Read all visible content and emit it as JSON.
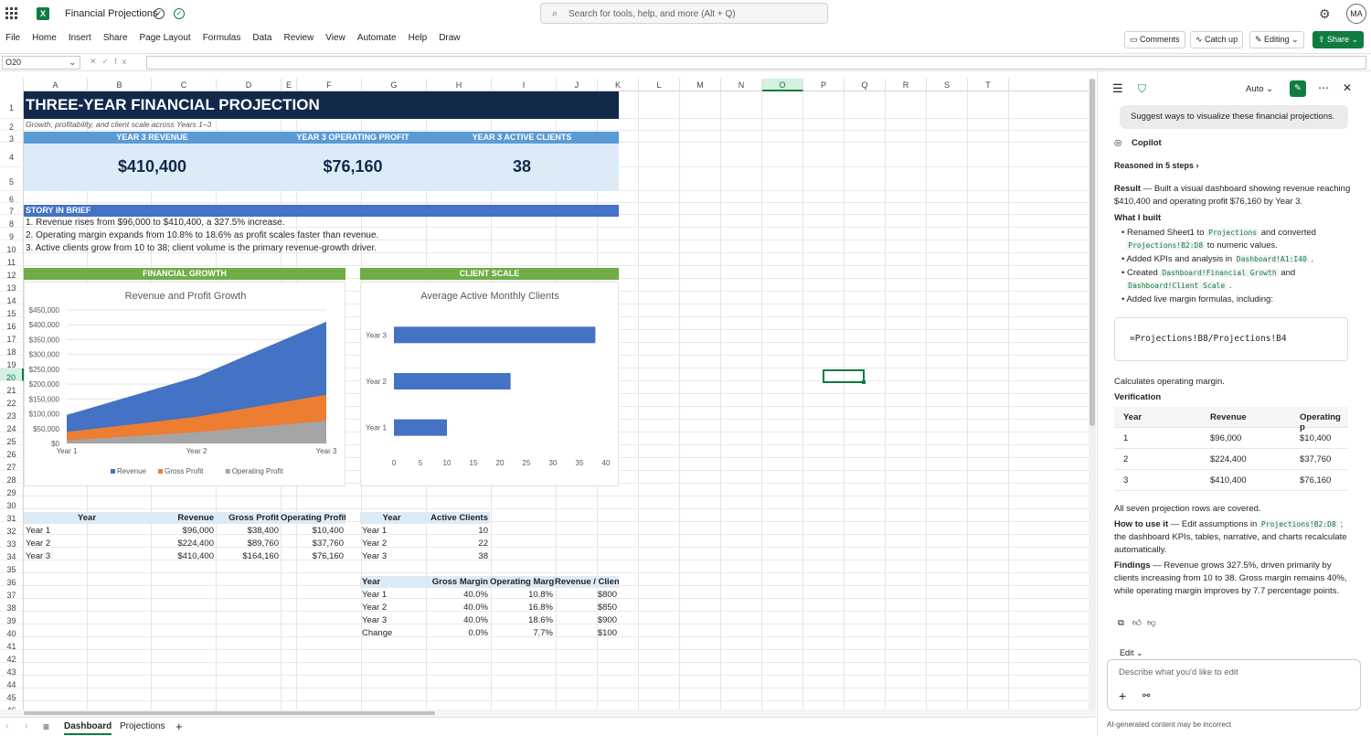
{
  "app": {
    "title": "Financial Projections",
    "search_placeholder": "Search for tools, help, and more (Alt + Q)",
    "avatar": "MA"
  },
  "menu": [
    "File",
    "Home",
    "Insert",
    "Share",
    "Page Layout",
    "Formulas",
    "Data",
    "Review",
    "View",
    "Automate",
    "Help",
    "Draw"
  ],
  "ribbon_buttons": {
    "comments": "Comments",
    "catchup": "Catch up",
    "editing": "Editing",
    "share": "Share"
  },
  "namebox": "O20",
  "columns": [
    "A",
    "B",
    "C",
    "D",
    "E",
    "F",
    "G",
    "H",
    "I",
    "J",
    "K",
    "L",
    "M",
    "N",
    "O",
    "P",
    "Q",
    "R",
    "S",
    "T"
  ],
  "rows": [
    "1",
    "2",
    "3",
    "4",
    "5",
    "6",
    "7",
    "8",
    "9",
    "10",
    "11",
    "12",
    "13",
    "14",
    "15",
    "16",
    "17",
    "18",
    "19",
    "20",
    "21",
    "22",
    "23",
    "24",
    "25",
    "26",
    "27",
    "28",
    "29",
    "30",
    "31",
    "32",
    "33",
    "34",
    "35",
    "36",
    "37",
    "38",
    "39",
    "40",
    "41",
    "42",
    "43",
    "44",
    "45",
    "46"
  ],
  "sheet": {
    "title": "THREE-YEAR FINANCIAL PROJECTION",
    "subtitle": "Growth, profitability, and client scale across Years 1–3",
    "kpis": [
      {
        "label": "YEAR 3 REVENUE",
        "value": "$410,400"
      },
      {
        "label": "YEAR 3 OPERATING PROFIT",
        "value": "$76,160"
      },
      {
        "label": "YEAR 3 ACTIVE CLIENTS",
        "value": "38"
      }
    ],
    "story_title": "STORY IN BRIEF",
    "story": [
      "1. Revenue rises from $96,000 to $410,400, a 327.5% increase.",
      "2. Operating margin expands from 10.8% to 18.6% as profit scales faster than revenue.",
      "3. Active clients grow from 10 to 38; client volume is the primary revenue-growth driver."
    ],
    "sec_growth": "FINANCIAL GROWTH",
    "sec_clients": "CLIENT SCALE",
    "fin_headers": [
      "Year",
      "Revenue",
      "Gross Profit",
      "Operating Profit"
    ],
    "fin_rows": [
      [
        "Year 1",
        "$96,000",
        "$38,400",
        "$10,400"
      ],
      [
        "Year 2",
        "$224,400",
        "$89,760",
        "$37,760"
      ],
      [
        "Year 3",
        "$410,400",
        "$164,160",
        "$76,160"
      ]
    ],
    "cl_headers": [
      "Year",
      "Active Clients"
    ],
    "cl_rows": [
      [
        "Year 1",
        "10"
      ],
      [
        "Year 2",
        "22"
      ],
      [
        "Year 3",
        "38"
      ]
    ],
    "mg_headers": [
      "Year",
      "Gross Margin",
      "Operating Margin",
      "Revenue / Client"
    ],
    "mg_rows": [
      [
        "Year 1",
        "40.0%",
        "10.8%",
        "$800"
      ],
      [
        "Year 2",
        "40.0%",
        "16.8%",
        "$850"
      ],
      [
        "Year 3",
        "40.0%",
        "18.6%",
        "$900"
      ],
      [
        "Change",
        "0.0%",
        "7.7%",
        "$100"
      ]
    ]
  },
  "chart_data": [
    {
      "type": "area",
      "title": "Revenue and Profit Growth",
      "categories": [
        "Year 1",
        "Year 2",
        "Year 3"
      ],
      "ylim": [
        0,
        450000
      ],
      "yticks": [
        "$0",
        "$50,000",
        "$100,000",
        "$150,000",
        "$200,000",
        "$250,000",
        "$300,000",
        "$350,000",
        "$400,000",
        "$450,000"
      ],
      "series": [
        {
          "name": "Revenue",
          "values": [
            96000,
            224400,
            410400
          ],
          "color": "#4472c4"
        },
        {
          "name": "Gross Profit",
          "values": [
            38400,
            89760,
            164160
          ],
          "color": "#ed7d31"
        },
        {
          "name": "Operating Profit",
          "values": [
            10400,
            37760,
            76160
          ],
          "color": "#a5a5a5"
        }
      ],
      "legend": "bottom"
    },
    {
      "type": "bar",
      "title": "Average Active Monthly Clients",
      "categories": [
        "Year 1",
        "Year 2",
        "Year 3"
      ],
      "values": [
        10,
        22,
        38
      ],
      "xlim": [
        0,
        40
      ],
      "xticks": [
        "0",
        "5",
        "10",
        "15",
        "20",
        "25",
        "30",
        "35",
        "40"
      ],
      "color": "#4472c4"
    }
  ],
  "sheet_tabs": [
    "Dashboard",
    "Projections"
  ],
  "copilot": {
    "mode": "Auto",
    "prompt": "Suggest ways to visualize these financial projections.",
    "name": "Copilot",
    "reasoned": "Reasoned in 5 steps",
    "result_pre": "Result",
    "result_body": " — Built a visual dashboard showing revenue reaching $410,400 and operating profit $76,160 by Year 3.",
    "what_built": "What I built",
    "b1a": "Renamed Sheet1 to ",
    "b1code": "Projections",
    "b1b": " and converted",
    "b1code2": "Projections!B2:D8",
    "b1c": " to numeric values.",
    "b2a": "Added KPIs and analysis in ",
    "b2code": "Dashboard!A1:I40",
    "b2b": " .",
    "b3a": "Created ",
    "b3code": "Dashboard!Financial Growth",
    "b3b": " and",
    "b3code2": "Dashboard!Client Scale",
    "b3c": " .",
    "b4": "Added live margin formulas, including:",
    "formula": "=Projections!B8/Projections!B4",
    "calc": "Calculates operating margin.",
    "verification": "Verification",
    "vt_headers": [
      "Year",
      "Revenue",
      "Operating p"
    ],
    "vt_rows": [
      [
        "1",
        "$96,000",
        "$10,400"
      ],
      [
        "2",
        "$224,400",
        "$37,760"
      ],
      [
        "3",
        "$410,400",
        "$76,160"
      ]
    ],
    "covered": "All seven projection rows are covered.",
    "howto_h": "How to use it",
    "howto_a": " — Edit assumptions in ",
    "howto_code": "Projections!B2:D8",
    "howto_b": " ; the dashboard KPIs, tables, narrative, and charts recalculate automatically.",
    "findings_h": "Findings",
    "findings": " — Revenue grows 327.5%, driven primarily by clients increasing from 10 to 38. Gross margin remains 40%, while operating margin improves by 7.7 percentage points.",
    "edit": "Edit",
    "input_placeholder": "Describe what you'd like to edit",
    "disclaimer": "AI-generated content may be incorrect"
  }
}
